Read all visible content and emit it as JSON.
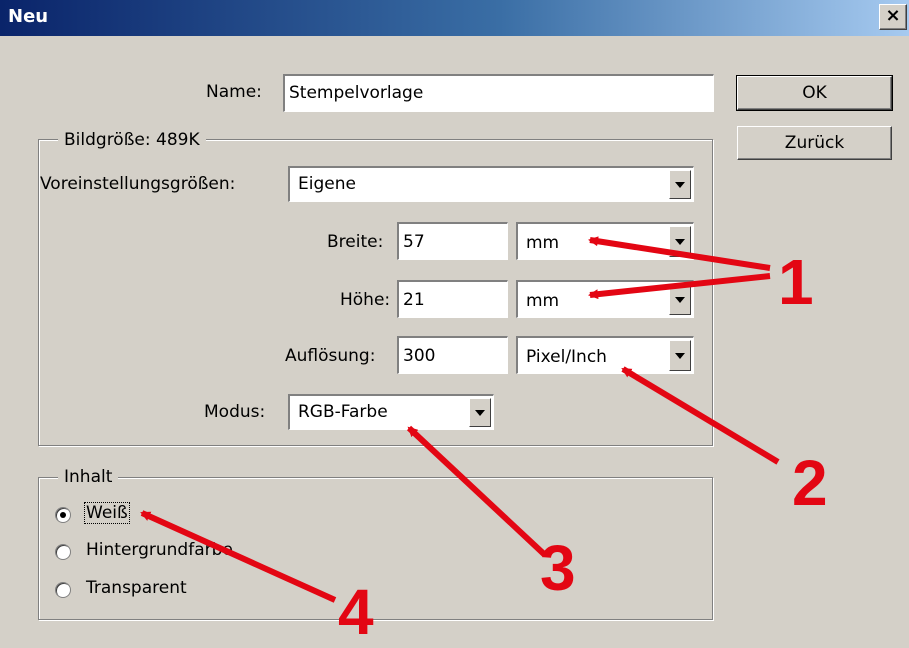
{
  "window": {
    "title": "Neu",
    "close_glyph": "×"
  },
  "name_field": {
    "label": "Name:",
    "value": "Stempelvorlage"
  },
  "buttons": {
    "ok": "OK",
    "reset": "Zurück"
  },
  "image_size": {
    "legend": "Bildgröße: 489K",
    "preset": {
      "label": "Voreinstellungsgrößen:",
      "value": "Eigene"
    },
    "width": {
      "label": "Breite:",
      "value": "57",
      "unit": "mm"
    },
    "height": {
      "label": "Höhe:",
      "value": "21",
      "unit": "mm"
    },
    "resolution": {
      "label": "Auflösung:",
      "value": "300",
      "unit": "Pixel/Inch"
    },
    "mode": {
      "label": "Modus:",
      "value": "RGB-Farbe"
    }
  },
  "content": {
    "legend": "Inhalt",
    "options": [
      {
        "label": "Weiß",
        "checked": true
      },
      {
        "label": "Hintergrundfarbe",
        "checked": false
      },
      {
        "label": "Transparent",
        "checked": false
      }
    ]
  },
  "annotations": {
    "arrow_color": "#e30613",
    "labels": [
      "1",
      "2",
      "3",
      "4"
    ]
  }
}
